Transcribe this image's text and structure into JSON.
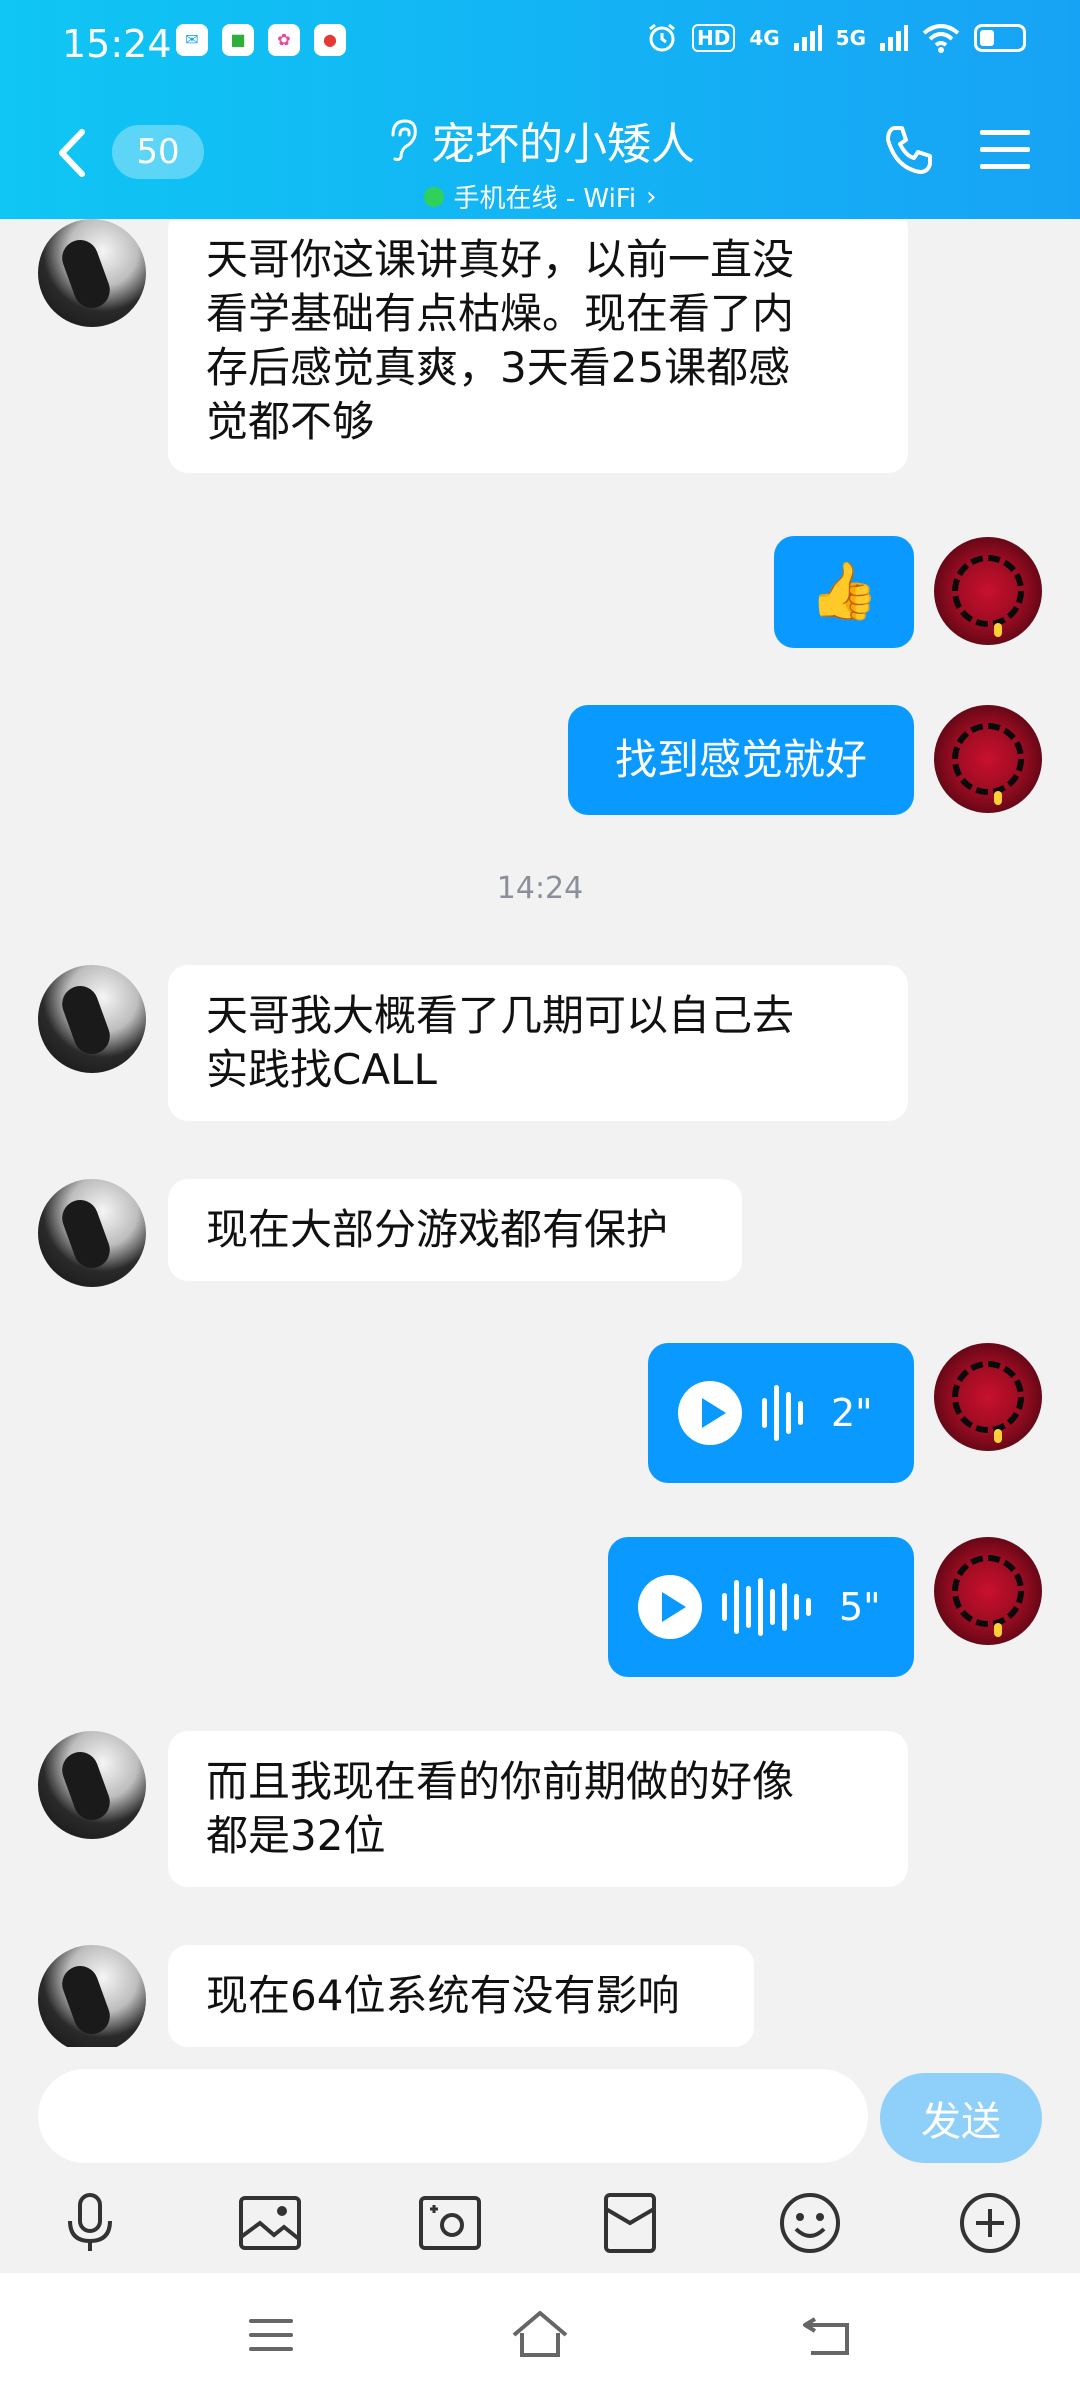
{
  "status_bar": {
    "time": "15:24",
    "network_1": "4G",
    "network_2": "5G",
    "hd_label": "HD",
    "battery_level": 0.35
  },
  "header": {
    "unread_count": "50",
    "contact_name": "宠坏的小矮人",
    "online_status": "手机在线 - WiFi",
    "status_chevron": "›"
  },
  "messages": [
    {
      "side": "in",
      "type": "text",
      "lines": [
        "天哥你这课讲真好，以前一直没",
        "看学基础有点枯燥。现在看了内",
        "存后感觉真爽，3天看25课都感",
        "觉都不够"
      ]
    },
    {
      "side": "out",
      "type": "emoji",
      "text": "👍"
    },
    {
      "side": "out",
      "type": "text",
      "text": "找到感觉就好"
    },
    {
      "side": "center",
      "type": "timestamp",
      "text": "14:24"
    },
    {
      "side": "in",
      "type": "text",
      "lines": [
        "天哥我大概看了几期可以自己去",
        "实践找CALL"
      ]
    },
    {
      "side": "in",
      "type": "text",
      "lines": [
        "现在大部分游戏都有保护"
      ]
    },
    {
      "side": "out",
      "type": "voice",
      "duration": "2\""
    },
    {
      "side": "out",
      "type": "voice",
      "duration": "5\""
    },
    {
      "side": "in",
      "type": "text",
      "lines": [
        "而且我现在看的你前期做的好像",
        "都是32位"
      ]
    },
    {
      "side": "in",
      "type": "text",
      "lines": [
        "现在64位系统有没有影响"
      ]
    }
  ],
  "composer": {
    "input_value": "",
    "send_label": "发送"
  },
  "toolbar_icons": [
    "microphone-icon",
    "photo-icon",
    "camera-icon",
    "red-packet-icon",
    "emoji-icon",
    "plus-icon"
  ],
  "colors": {
    "header_gradient_start": "#0fc6f4",
    "header_gradient_end": "#17a3f5",
    "outgoing_bubble": "#0a99ff",
    "incoming_bubble": "#ffffff",
    "chat_background": "#f2f2f2",
    "send_button": "#8fd0fb",
    "online_dot": "#2fd15a"
  }
}
